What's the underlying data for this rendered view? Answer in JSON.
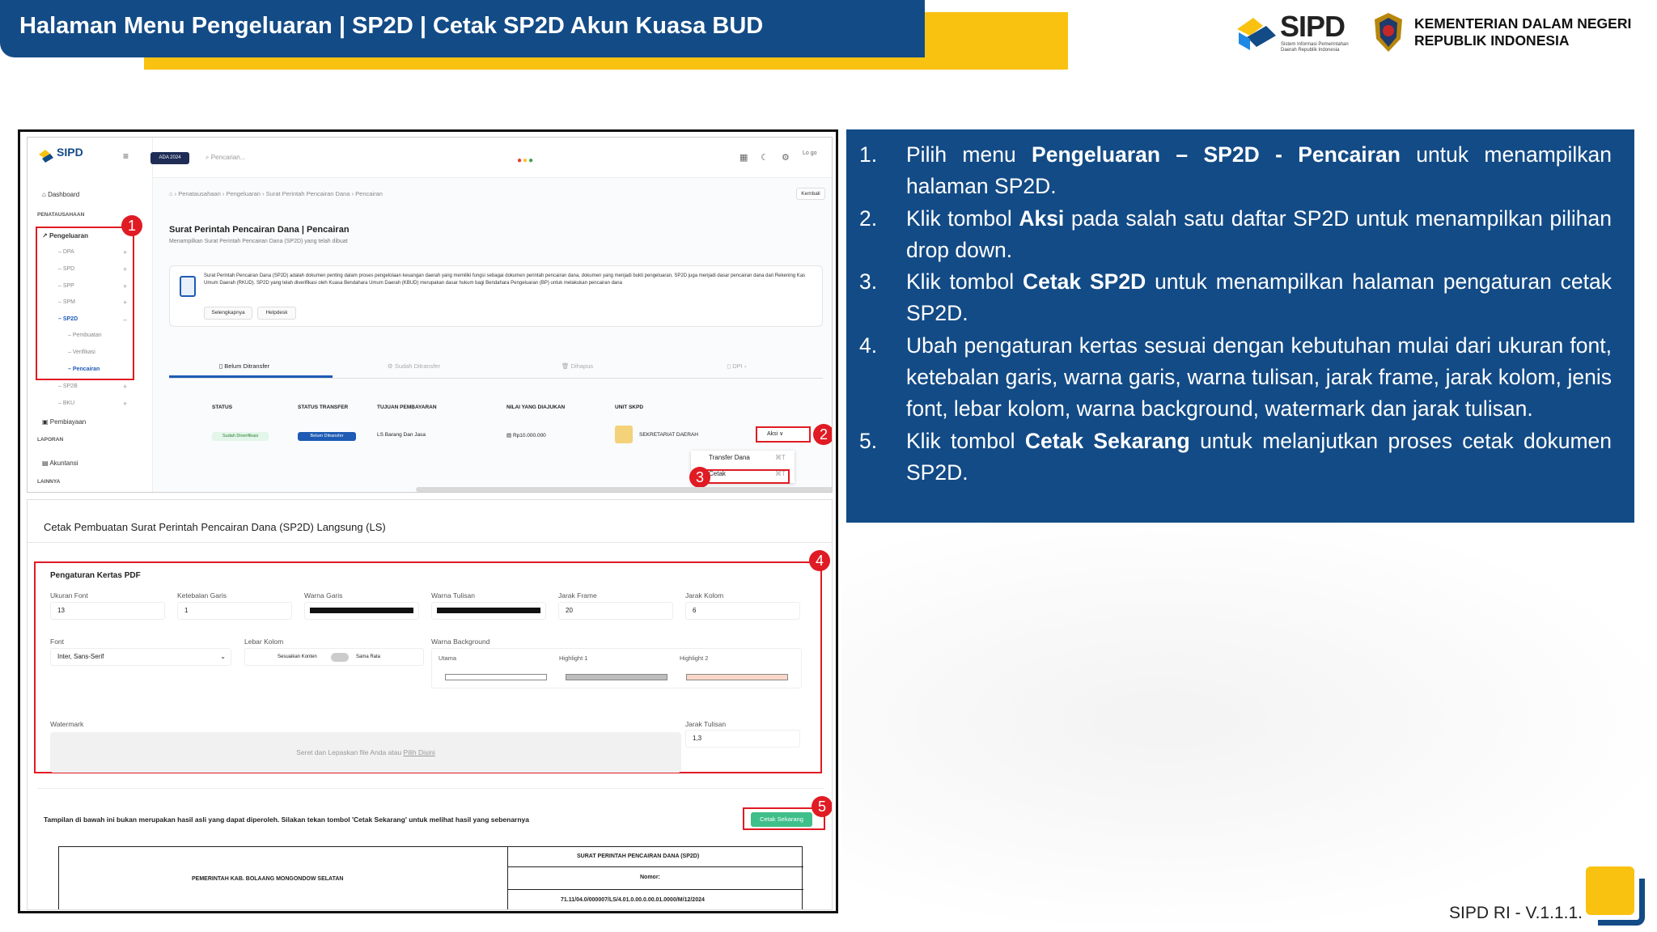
{
  "header": {
    "title": "Halaman Menu Pengeluaran | SP2D | Cetak SP2D Akun Kuasa BUD",
    "logo_text": "SIPD",
    "logo_subtitle": "Sistem Informasi Pemerintahan Daerah Republik Indonesia",
    "ministry_line1": "KEMENTERIAN DALAM NEGERI",
    "ministry_line2": "REPUBLIK INDONESIA"
  },
  "steps": [
    {
      "num": "1.",
      "pre": "Pilih menu ",
      "bold": "Pengeluaran – SP2D - Pencairan",
      "post": " untuk menampilkan halaman SP2D."
    },
    {
      "num": "2.",
      "pre": "Klik tombol ",
      "bold": "Aksi",
      "post": " pada salah satu daftar SP2D untuk menampilkan pilihan drop down."
    },
    {
      "num": "3.",
      "pre": "Klik tombol ",
      "bold": "Cetak SP2D",
      "post": " untuk menampilkan halaman pengaturan cetak SP2D."
    },
    {
      "num": "4.",
      "pre": "Ubah pengaturan kertas sesuai dengan kebutuhan mulai dari ukuran font, ketebalan garis, warna garis, warna tulisan, jarak frame, jarak kolom, jenis font, lebar kolom, warna background, watermark dan jarak tulisan.",
      "bold": "",
      "post": ""
    },
    {
      "num": "5.",
      "pre": "Klik tombol ",
      "bold": "Cetak Sekarang",
      "post": " untuk melanjutkan proses cetak dokumen SP2D."
    }
  ],
  "version": "SIPD RI - V.1.1.1.",
  "colors": {
    "navy": "#134b86",
    "yellow": "#f9c211",
    "highlight": "#e01b24"
  },
  "app": {
    "logo": "SIPD",
    "year_pill": "ADA 2024",
    "search_placeholder": "Pencarian...",
    "avatar_alt": "Lo go",
    "sidebar": {
      "dashboard": "Dashboard",
      "sec_penatausahaan": "PENATAUSAHAAN",
      "pengeluaran": "Pengeluaran",
      "items": [
        "DPA",
        "SPD",
        "SPP",
        "SPM",
        "SP2D"
      ],
      "sp2d_sub": [
        "Pembuatan",
        "Verifikasi",
        "Pencairan"
      ],
      "items2": [
        "SP2B",
        "BKU"
      ],
      "pembiayaan": "Pembiayaan",
      "sec_laporan": "LAPORAN",
      "akuntansi": "Akuntansi",
      "sec_lainnya": "LAINNYA"
    },
    "breadcrumb": [
      "Penatausahaan",
      "Pengeluaran",
      "Surat Perintah Pencairan Dana",
      "Pencairan"
    ],
    "back_button": "Kembali",
    "page_title": "Surat Perintah Pencairan Dana | Pencairan",
    "page_subtitle": "Menampilkan Surat Perintah Pencairan Dana (SP2D) yang telah dibuat",
    "info_text": "Surat Perintah Pencairan Dana (SP2D) adalah dokumen penting dalam proses pengelolaan keuangan daerah yang memiliki fungsi sebagai dokumen perintah pencairan dana, dokumen yang menjadi bukti pengeluaran, SP2D juga menjadi dasar pencairan dana dari Rekening Kas Umum Daerah (RKUD). SP2D yang telah diverifikasi oleh Kuasa Bendahara Umum Daerah (KBUD) merupakan dasar hukum bagi Bendahara Pengeluaran (BP) untuk melakukan pencairan dana",
    "info_buttons": [
      "Selengkapnya",
      "Helpdesk"
    ],
    "tabs": [
      "Belum Ditransfer",
      "Sudah Ditransfer",
      "Dihapus",
      "DPI"
    ],
    "table_headers": [
      "STATUS",
      "STATUS TRANSFER",
      "TUJUAN PEMBAYARAN",
      "NILAI YANG DIAJUKAN",
      "UNIT SKPD"
    ],
    "row": {
      "status": "Sudah Diverifikasi",
      "transfer": "Belum Ditransfer",
      "tujuan": "LS Barang Dan Jasa",
      "nilai": "Rp10.000.000",
      "unit": "SEKRETARIAT DAERAH"
    },
    "aksi_label": "Aksi",
    "dropdown": [
      {
        "label": "Transfer Dana",
        "key": "⌘T"
      },
      {
        "label": "Cetak",
        "key": "⌘T"
      }
    ]
  },
  "print": {
    "title": "Cetak Pembuatan Surat Perintah Pencairan Dana (SP2D) Langsung (LS)",
    "section": "Pengaturan Kertas PDF",
    "fields_row1": [
      {
        "label": "Ukuran Font",
        "value": "13"
      },
      {
        "label": "Ketebalan Garis",
        "value": "1"
      },
      {
        "label": "Warna Garis",
        "value": ""
      },
      {
        "label": "Warna Tulisan",
        "value": ""
      },
      {
        "label": "Jarak Frame",
        "value": "20"
      },
      {
        "label": "Jarak Kolom",
        "value": "6"
      }
    ],
    "font_label": "Font",
    "font_value": "Inter, Sans-Serif",
    "lebar_label": "Lebar Kolom",
    "toggle_left": "Sesuaikan Konten",
    "toggle_right": "Sama Rata",
    "bg_label": "Warna Background",
    "bg_options": [
      "Utama",
      "Highlight 1",
      "Highlight 2"
    ],
    "watermark_label": "Watermark",
    "drop_text": "Seret dan Lepaskan file Anda atau ",
    "drop_link": "Pilih Disini",
    "jarak_tulisan_label": "Jarak Tulisan",
    "jarak_tulisan_value": "1,3",
    "note": "Tampilan di bawah ini bukan merupakan hasil asli yang dapat diperoleh. Silakan tekan tombol 'Cetak Sekarang' untuk melihat hasil yang sebenarnya",
    "cetak_button": "Cetak Sekarang",
    "doc_left": "PEMERINTAH KAB. BOLAANG MONGONDOW SELATAN",
    "doc_r1": "SURAT PERINTAH PENCAIRAN DANA (SP2D)",
    "doc_r2": "Nomor:",
    "doc_r3": "71.11/04.0/000007/LS/4.01.0.00.0.00.01.0000/M/12/2024"
  },
  "badges": [
    "1",
    "2",
    "3",
    "4",
    "5"
  ]
}
